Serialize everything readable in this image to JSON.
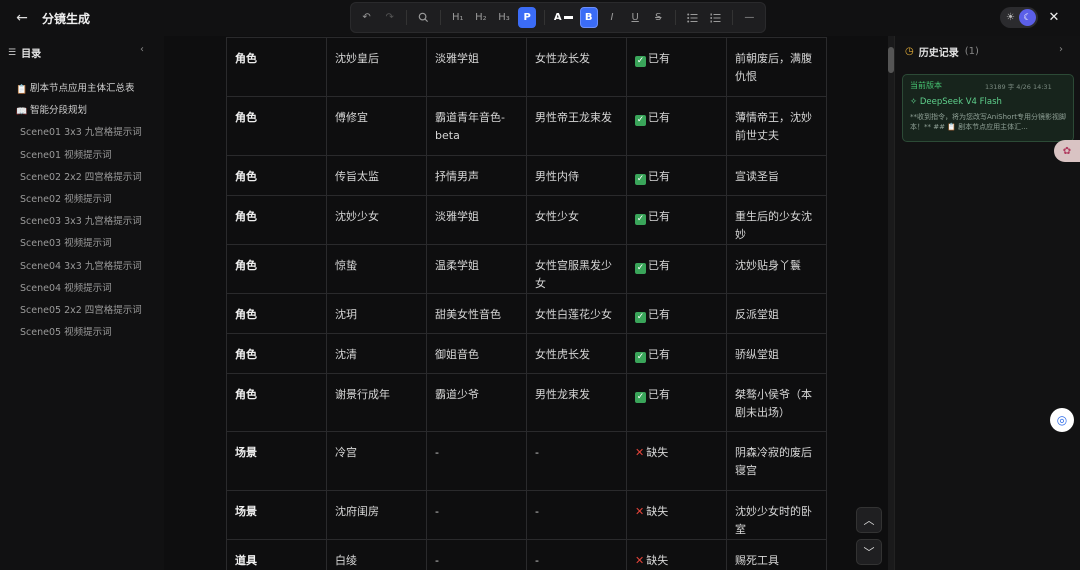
{
  "app": {
    "title": "分镜生成"
  },
  "toolbar": {
    "h1": "H₁",
    "h2": "H₂",
    "h3": "H₃",
    "paragraph": "P",
    "font_color": "A",
    "bold": "B",
    "italic": "I",
    "underline": "U",
    "strike": "S",
    "hr": "—"
  },
  "sidebar": {
    "title": "目录",
    "items": [
      {
        "label": "剧本节点应用主体汇总表",
        "emoji": "📋",
        "top": true
      },
      {
        "label": "智能分段规划",
        "emoji": "📖",
        "top": true
      },
      {
        "label": "Scene01 3x3 九宫格提示词"
      },
      {
        "label": "Scene01 视频提示词"
      },
      {
        "label": "Scene02 2x2 四宫格提示词"
      },
      {
        "label": "Scene02 视频提示词"
      },
      {
        "label": "Scene03 3x3 九宫格提示词"
      },
      {
        "label": "Scene03 视频提示词"
      },
      {
        "label": "Scene04 3x3 九宫格提示词"
      },
      {
        "label": "Scene04 视频提示词"
      },
      {
        "label": "Scene05 2x2 四宫格提示词"
      },
      {
        "label": "Scene05 视频提示词"
      }
    ]
  },
  "table": {
    "rows": [
      {
        "type": "角色",
        "name": "沈妙皇后",
        "voice": "淡雅学姐",
        "look": "女性龙长发",
        "status": "已有",
        "ok": true,
        "desc": "前朝废后，满腹仇恨"
      },
      {
        "type": "角色",
        "name": "傅修宜",
        "voice": "霸道青年音色-beta",
        "look": "男性帝王龙束发",
        "status": "已有",
        "ok": true,
        "desc": "薄情帝王，沈妙前世丈夫"
      },
      {
        "type": "角色",
        "name": "传旨太监",
        "voice": "抒情男声",
        "look": "男性内侍",
        "status": "已有",
        "ok": true,
        "desc": "宣读圣旨"
      },
      {
        "type": "角色",
        "name": "沈妙少女",
        "voice": "淡雅学姐",
        "look": "女性少女",
        "status": "已有",
        "ok": true,
        "desc": "重生后的少女沈妙"
      },
      {
        "type": "角色",
        "name": "惊蛰",
        "voice": "温柔学姐",
        "look": "女性宫服黑发少女",
        "status": "已有",
        "ok": true,
        "desc": "沈妙贴身丫鬟"
      },
      {
        "type": "角色",
        "name": "沈玥",
        "voice": "甜美女性音色",
        "look": "女性白莲花少女",
        "status": "已有",
        "ok": true,
        "desc": "反派堂姐"
      },
      {
        "type": "角色",
        "name": "沈清",
        "voice": "御姐音色",
        "look": "女性虎长发",
        "status": "已有",
        "ok": true,
        "desc": "骄纵堂姐"
      },
      {
        "type": "角色",
        "name": "谢景行成年",
        "voice": "霸道少爷",
        "look": "男性龙束发",
        "status": "已有",
        "ok": true,
        "desc": "桀骜小侯爷（本剧未出场）"
      },
      {
        "type": "场景",
        "name": "冷宫",
        "voice": "-",
        "look": "-",
        "status": "缺失",
        "ok": false,
        "desc": "阴森冷寂的废后寝宫"
      },
      {
        "type": "场景",
        "name": "沈府闺房",
        "voice": "-",
        "look": "-",
        "status": "缺失",
        "ok": false,
        "desc": "沈妙少女时的卧室"
      },
      {
        "type": "道具",
        "name": "白绫",
        "voice": "-",
        "look": "-",
        "status": "缺失",
        "ok": false,
        "desc": "赐死工具"
      }
    ]
  },
  "history": {
    "title": "历史记录",
    "count": "(1)",
    "card": {
      "label": "当前版本",
      "meta": "13189 字   4/26 14:31",
      "model": "DeepSeek V4 Flash",
      "excerpt": "**收到指令，将为您改写AniShort专用分镜影视脚本！** ## 📋 剧本节点应用主体汇..."
    }
  },
  "colors": {
    "accent": "#3b6cf6",
    "ok": "#3aa55a",
    "missing": "#e2443a",
    "history_green": "#46c271"
  }
}
